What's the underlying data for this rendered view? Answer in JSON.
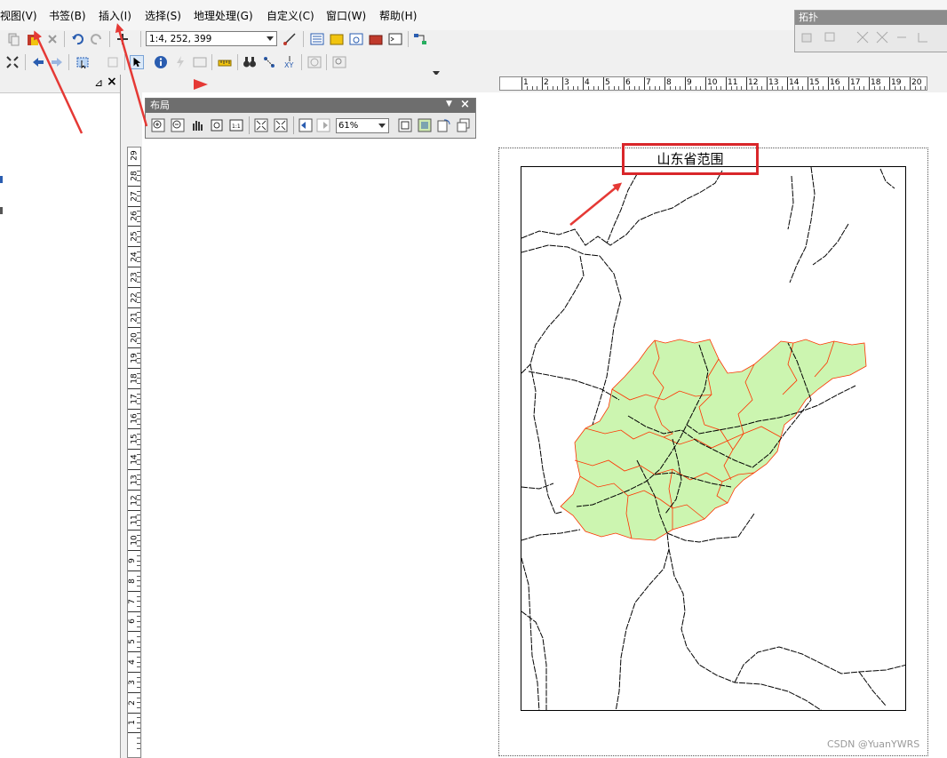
{
  "menu": {
    "items": [
      "视图(V)",
      "书签(B)",
      "插入(I)",
      "选择(S)",
      "地理处理(G)",
      "自定义(C)",
      "窗口(W)",
      "帮助(H)"
    ]
  },
  "toolbar": {
    "scale_value": "1:4, 252, 399"
  },
  "topology": {
    "title": "拓扑"
  },
  "layout_toolbar": {
    "title": "布局",
    "zoom_value": "61%"
  },
  "ruler": {
    "horizontal": [
      "1",
      "2",
      "3",
      "4",
      "5",
      "6",
      "7",
      "8",
      "9",
      "10",
      "11",
      "12",
      "13",
      "14",
      "15",
      "16",
      "17",
      "18",
      "19",
      "20"
    ],
    "vertical": [
      "29",
      "28",
      "27",
      "26",
      "25",
      "24",
      "23",
      "22",
      "21",
      "20",
      "19",
      "18",
      "17",
      "16",
      "15",
      "14",
      "13",
      "12",
      "11",
      "10",
      "9",
      "8",
      "7",
      "6",
      "5",
      "4",
      "3",
      "2",
      "1"
    ]
  },
  "map": {
    "title": "山东省范围",
    "fill_color": "#ccf5b0",
    "boundary_color": "#ff3300",
    "rail_color": "#000000"
  },
  "panel": {
    "pin_icon": "pin-icon",
    "close_icon": "close-icon"
  },
  "watermark": "CSDN @YuanYWRS",
  "annotation_color": "#e53935"
}
